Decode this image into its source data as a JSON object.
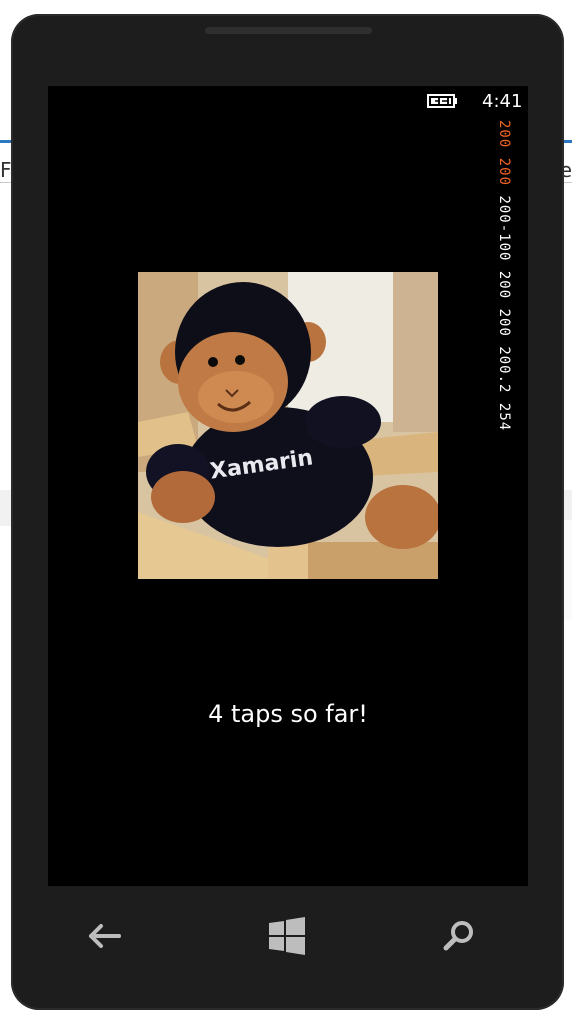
{
  "status_bar": {
    "time": "4:41",
    "battery_icon": "battery-charging-icon"
  },
  "fps_counter": {
    "red_part": "200 200",
    "white_part": "200-100 200 200 200.2 254"
  },
  "main": {
    "image_alt": "Stuffed Xamarin monkey toy",
    "image_shirt_text": "Xamarin",
    "tap_label": "4 taps so far!"
  },
  "nav": {
    "back_icon": "back-arrow-icon",
    "start_icon": "windows-start-icon",
    "search_icon": "search-icon"
  },
  "colors": {
    "phone_body": "#1d1d1d",
    "screen": "#000000",
    "fps_red": "#f26522",
    "background_accent": "#2b79c2"
  },
  "background": {
    "left_fragment": "Fa",
    "right_fragment": "e"
  }
}
